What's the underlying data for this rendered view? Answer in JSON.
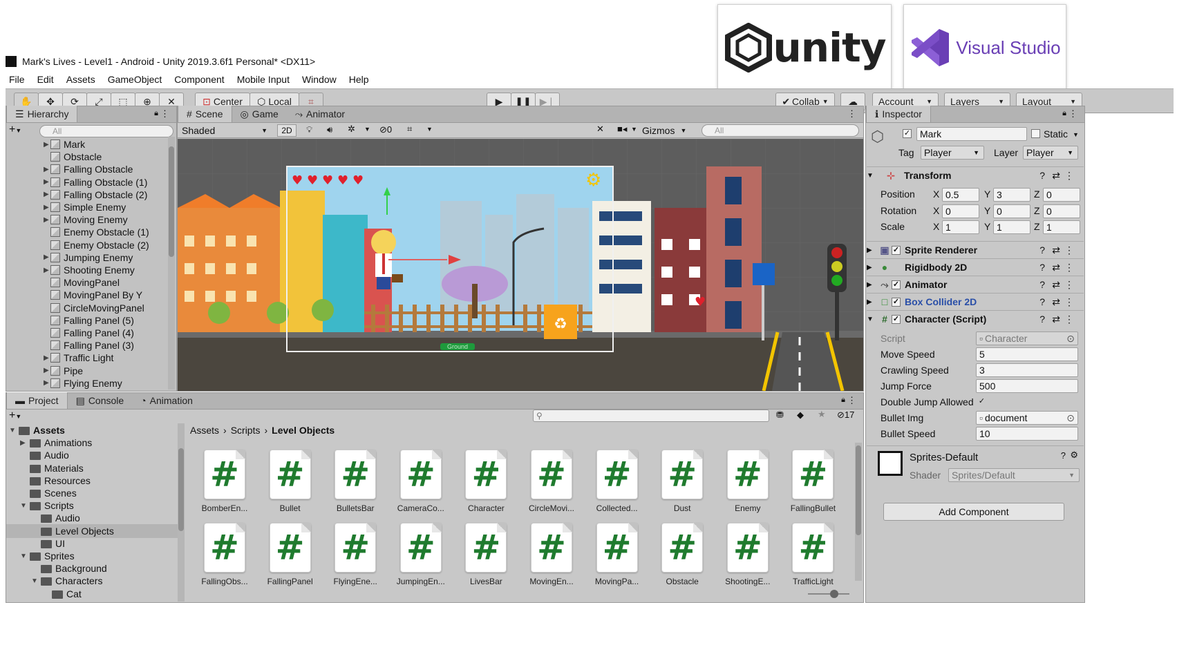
{
  "logos": {
    "unity_text": "unity",
    "vs_text": "Visual Studio"
  },
  "window": {
    "title": "Mark's Lives - Level1 - Android - Unity 2019.3.6f1 Personal* <DX11>"
  },
  "menu": [
    "File",
    "Edit",
    "Assets",
    "GameObject",
    "Component",
    "Mobile Input",
    "Window",
    "Help"
  ],
  "toolbar": {
    "center_label": "Center",
    "local_label": "Local",
    "collab_label": "Collab",
    "account_label": "Account",
    "layers_label": "Layers",
    "layout_label": "Layout"
  },
  "hierarchy": {
    "tab": "Hierarchy",
    "search_placeholder": "All",
    "items": [
      {
        "label": "Mark",
        "expand": true
      },
      {
        "label": "Obstacle",
        "expand": false
      },
      {
        "label": "Falling Obstacle",
        "expand": true
      },
      {
        "label": "Falling Obstacle (1)",
        "expand": true
      },
      {
        "label": "Falling Obstacle (2)",
        "expand": true
      },
      {
        "label": "Simple Enemy",
        "expand": true
      },
      {
        "label": "Moving Enemy",
        "expand": true
      },
      {
        "label": "Enemy Obstacle (1)",
        "expand": false
      },
      {
        "label": "Enemy Obstacle (2)",
        "expand": false
      },
      {
        "label": "Jumping Enemy",
        "expand": true
      },
      {
        "label": "Shooting Enemy",
        "expand": true
      },
      {
        "label": "MovingPanel",
        "expand": false
      },
      {
        "label": "MovingPanel By Y",
        "expand": false
      },
      {
        "label": "CircleMovingPanel",
        "expand": false
      },
      {
        "label": "Falling Panel (5)",
        "expand": false
      },
      {
        "label": "Falling Panel (4)",
        "expand": false
      },
      {
        "label": "Falling Panel (3)",
        "expand": false
      },
      {
        "label": "Traffic Light",
        "expand": true
      },
      {
        "label": "Pipe",
        "expand": true
      },
      {
        "label": "Flying Enemy",
        "expand": true
      }
    ]
  },
  "scene": {
    "tabs": [
      "Scene",
      "Game",
      "Animator"
    ],
    "shading": "Shaded",
    "mode_2d": "2D",
    "hidden_count": "0",
    "gizmos": "Gizmos",
    "search_placeholder": "All",
    "ground_label": "Ground"
  },
  "inspector": {
    "tab": "Inspector",
    "object_name": "Mark",
    "static_label": "Static",
    "tag_label": "Tag",
    "tag_value": "Player",
    "layer_label": "Layer",
    "layer_value": "Player",
    "transform": {
      "title": "Transform",
      "rows": [
        {
          "label": "Position",
          "x": "0.5",
          "y": "3",
          "z": "0"
        },
        {
          "label": "Rotation",
          "x": "0",
          "y": "0",
          "z": "0"
        },
        {
          "label": "Scale",
          "x": "1",
          "y": "1",
          "z": "1"
        }
      ]
    },
    "components": [
      "Sprite Renderer",
      "Rigidbody 2D",
      "Animator",
      "Box Collider 2D",
      "Character (Script)"
    ],
    "script_props": [
      {
        "label": "Script",
        "value": "Character"
      },
      {
        "label": "Move Speed",
        "value": "5"
      },
      {
        "label": "Crawling Speed",
        "value": "3"
      },
      {
        "label": "Jump Force",
        "value": "500"
      },
      {
        "label": "Double Jump Allowed",
        "value": "✓"
      },
      {
        "label": "Bullet Img",
        "value": "document"
      },
      {
        "label": "Bullet Speed",
        "value": "10"
      }
    ],
    "material_name": "Sprites-Default",
    "shader_label": "Shader",
    "shader_value": "Sprites/Default",
    "add_component": "Add Component"
  },
  "project": {
    "tabs": [
      "Project",
      "Console",
      "Animation"
    ],
    "hidden_count": "17",
    "breadcrumb": [
      "Assets",
      "Scripts",
      "Level Objects"
    ],
    "tree": [
      {
        "label": "Assets",
        "depth": 0,
        "open": true,
        "bold": true
      },
      {
        "label": "Animations",
        "depth": 1,
        "open": false
      },
      {
        "label": "Audio",
        "depth": 1
      },
      {
        "label": "Materials",
        "depth": 1
      },
      {
        "label": "Resources",
        "depth": 1
      },
      {
        "label": "Scenes",
        "depth": 1
      },
      {
        "label": "Scripts",
        "depth": 1,
        "open": true
      },
      {
        "label": "Audio",
        "depth": 2
      },
      {
        "label": "Level Objects",
        "depth": 2,
        "selected": true
      },
      {
        "label": "UI",
        "depth": 2
      },
      {
        "label": "Sprites",
        "depth": 1,
        "open": true
      },
      {
        "label": "Background",
        "depth": 2
      },
      {
        "label": "Characters",
        "depth": 2,
        "open": true
      },
      {
        "label": "Cat",
        "depth": 3
      }
    ],
    "assets": [
      "BomberEn...",
      "Bullet",
      "BulletsBar",
      "CameraCo...",
      "Character",
      "CircleMovi...",
      "Collected...",
      "Dust",
      "Enemy",
      "FallingBullet",
      "FallingObs...",
      "FallingPanel",
      "FlyingEne...",
      "JumpingEn...",
      "LivesBar",
      "MovingEn...",
      "MovingPa...",
      "Obstacle",
      "ShootingE...",
      "TrafficLight"
    ]
  },
  "colors": {
    "accent": "#3a7bd5",
    "script_green": "#1f7b2e",
    "sky": "#9fd4ee",
    "heart": "#e0202c"
  }
}
